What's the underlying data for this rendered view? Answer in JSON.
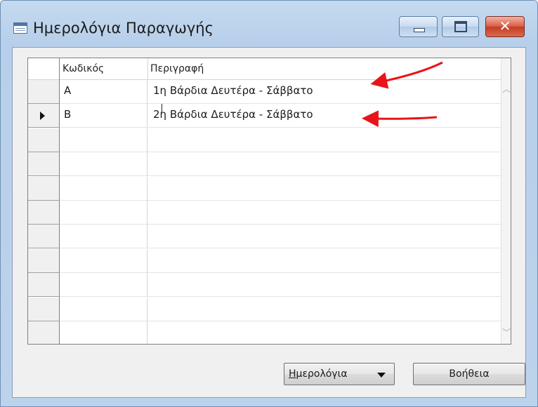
{
  "window": {
    "title": "Ημερολόγια Παραγωγής",
    "icon": "table-icon",
    "controls": {
      "minimize": "minimize-icon",
      "maximize": "maximize-icon",
      "close": "✕"
    }
  },
  "table": {
    "columns": [
      "Κωδικός",
      "Περιγραφή"
    ],
    "rows": [
      {
        "code": "A",
        "description": "1η Βάρδια Δευτέρα - Σάββατο",
        "current": false
      },
      {
        "code": "B",
        "description": "2η Βάρδια Δευτέρα - Σάββατο",
        "current": true
      }
    ],
    "empty_rows": 9
  },
  "buttons": {
    "calendar_accel": "Η",
    "calendar_rest": "μερολόγια",
    "help": "Βοήθεια"
  },
  "annotations": {
    "arrow_color": "#e8141a",
    "arrows": 2
  }
}
